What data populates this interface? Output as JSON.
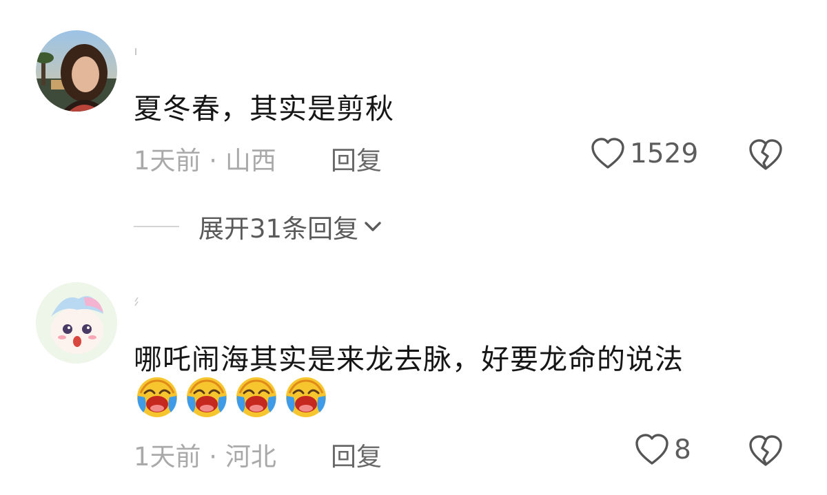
{
  "comments": [
    {
      "text": "夏冬春，其实是剪秋",
      "meta": "1天前 · 山西",
      "reply_label": "回复",
      "likes": "1529"
    },
    {
      "text": "哪吒闹海其实是来龙去脉，好要龙命的说法",
      "emoji_count": 4,
      "emoji_name": "laugh-cry-emoji",
      "meta": "1天前 · 河北",
      "reply_label": "回复",
      "likes": "8"
    }
  ],
  "expand": {
    "label": "展开31条回复"
  },
  "icons": {
    "like": "heart-outline-icon",
    "dislike": "broken-heart-icon",
    "expand": "chevron-down-icon"
  },
  "colors": {
    "text": "#161616",
    "meta": "#a9a9a9",
    "action": "#686868",
    "icon": "#555555"
  }
}
